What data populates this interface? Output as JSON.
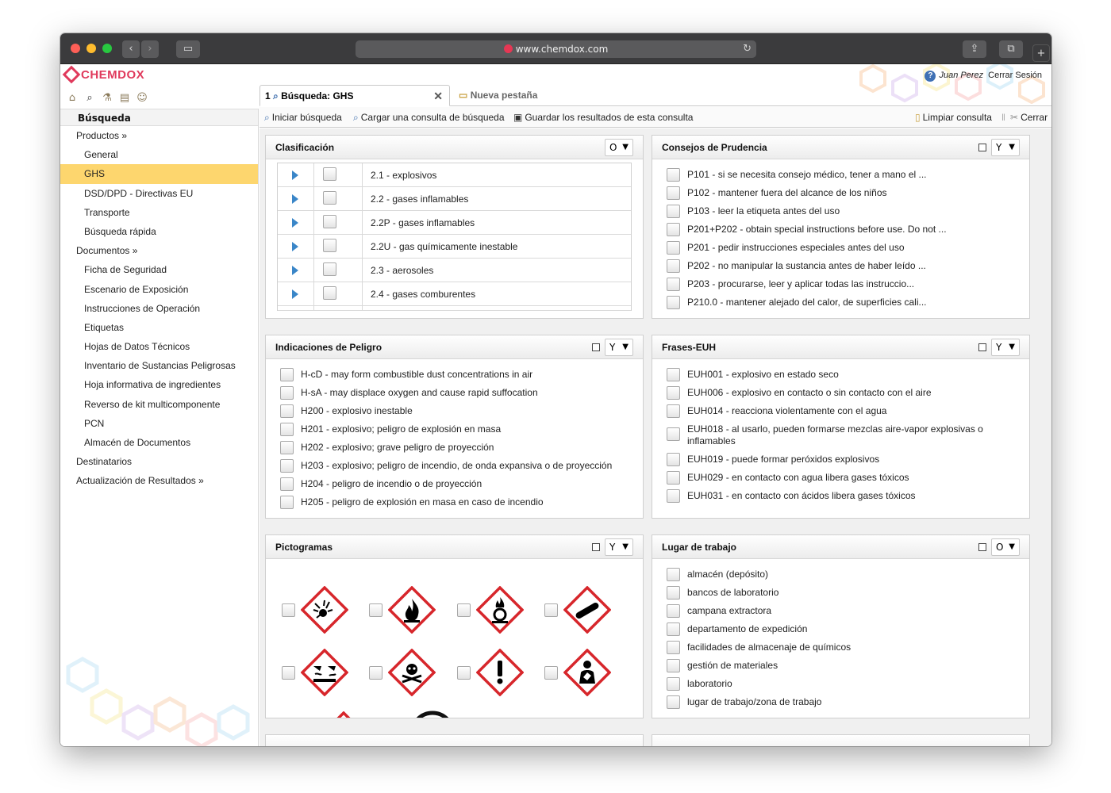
{
  "browser": {
    "url": "www.chemdox.com"
  },
  "app": {
    "logo": "CHEMDOX",
    "user_name": "Juan Perez",
    "logout": "Cerrar Sesión"
  },
  "sidebar": {
    "header": "Búsqueda",
    "items": [
      {
        "label": "Productos »",
        "level": 0
      },
      {
        "label": "General",
        "level": 1
      },
      {
        "label": "GHS",
        "level": 1,
        "active": true
      },
      {
        "label": "DSD/DPD - Directivas EU",
        "level": 1
      },
      {
        "label": "Transporte",
        "level": 1
      },
      {
        "label": "Búsqueda rápida",
        "level": 1
      },
      {
        "label": "Documentos »",
        "level": 0
      },
      {
        "label": "Ficha de Seguridad",
        "level": 1
      },
      {
        "label": "Escenario de Exposición",
        "level": 1
      },
      {
        "label": "Instrucciones de Operación",
        "level": 1
      },
      {
        "label": "Etiquetas",
        "level": 1
      },
      {
        "label": "Hojas de Datos Técnicos",
        "level": 1
      },
      {
        "label": "Inventario de Sustancias Peligrosas",
        "level": 1
      },
      {
        "label": "Hoja informativa de ingredientes",
        "level": 1
      },
      {
        "label": "Reverso de kit multicomponente",
        "level": 1
      },
      {
        "label": "PCN",
        "level": 1
      },
      {
        "label": "Almacén de Documentos",
        "level": 1
      },
      {
        "label": "Destinatarios",
        "level": 0
      },
      {
        "label": "Actualización de Resultados »",
        "level": 0
      }
    ]
  },
  "tabs": {
    "active_number": "1",
    "active_label": "Búsqueda: GHS",
    "new_tab": "Nueva pestaña"
  },
  "toolbar": {
    "start": "Iniciar búsqueda",
    "load": "Cargar una consulta de búsqueda",
    "save": "Guardar los resultados de esta consulta",
    "clear": "Limpiar consulta",
    "close": "Cerrar"
  },
  "panels": {
    "clasificacion": {
      "title": "Clasificación",
      "op": "O",
      "rows": [
        "2.1 - explosivos",
        "2.2 - gases inflamables",
        "2.2P - gases inflamables",
        "2.2U - gas químicamente inestable",
        "2.3 - aerosoles",
        "2.4 - gases comburentes"
      ]
    },
    "consejos": {
      "title": "Consejos de Prudencia",
      "op": "Y",
      "rows": [
        "P101 - si se necesita consejo médico, tener a mano el ...",
        "P102 - mantener fuera del alcance de los niños",
        "P103 - leer la etiqueta antes del uso",
        "P201+P202 - obtain special instructions before use. Do not ...",
        "P201 - pedir instrucciones especiales antes del uso",
        "P202 - no manipular la sustancia antes de haber leído ...",
        "P203 - procurarse, leer y aplicar todas las instruccio...",
        "P210.0 - mantener alejado del calor, de superficies cali..."
      ]
    },
    "indicaciones": {
      "title": "Indicaciones de Peligro",
      "op": "Y",
      "rows": [
        "H-cD - may form combustible dust concentrations in air",
        "H-sA - may displace oxygen and cause rapid suffocation",
        "H200 - explosivo inestable",
        "H201 - explosivo; peligro de explosión en masa",
        "H202 - explosivo; grave peligro de proyección",
        "H203 - explosivo; peligro de incendio, de onda expansiva o de proyección",
        "H204 - peligro de incendio o de proyección",
        "H205 - peligro de explosión en masa en caso de incendio"
      ]
    },
    "frases": {
      "title": "Frases-EUH",
      "op": "Y",
      "rows": [
        "EUH001 - explosivo en estado seco",
        "EUH006 - explosivo en contacto o sin contacto con el aire",
        "EUH014 - reacciona violentamente con el agua",
        "EUH018 - al usarlo, pueden formarse mezclas aire-vapor explosivas o inflamables",
        "EUH019 - puede formar peróxidos explosivos",
        "EUH029 - en contacto con agua libera gases tóxicos",
        "EUH031 - en contacto con ácidos libera gases tóxicos"
      ]
    },
    "pictogramas": {
      "title": "Pictogramas",
      "op": "Y",
      "icons": [
        "exploding-bomb-icon",
        "flame-icon",
        "flame-over-circle-icon",
        "gas-cylinder-icon",
        "corrosion-icon",
        "skull-crossbones-icon",
        "exclamation-mark-icon",
        "health-hazard-icon"
      ]
    },
    "lugar": {
      "title": "Lugar de trabajo",
      "op": "O",
      "rows": [
        "almacén (depósito)",
        "bancos de laboratorio",
        "campana extractora",
        "departamento de expedición",
        "facilidades de almacenaje de químicos",
        "gestión de materiales",
        "laboratorio",
        "lugar de trabajo/zona de trabajo"
      ]
    }
  },
  "colors": {
    "active_sidebar": "#fdd66e",
    "ghs_red": "#d7262b",
    "brand": "#e03a5c",
    "arrow": "#3a86c8"
  }
}
